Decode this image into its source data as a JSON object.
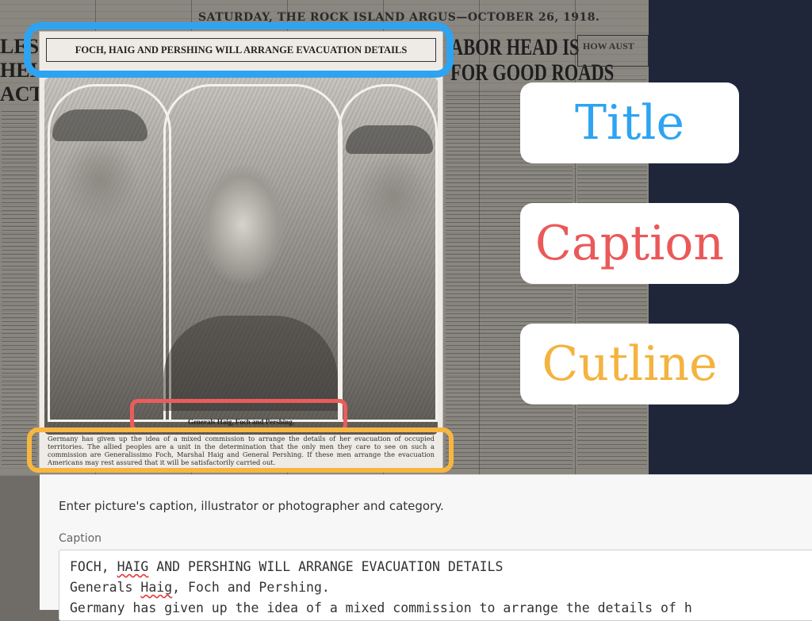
{
  "newspaper": {
    "masthead": "SATURDAY, THE ROCK ISLAND ARGUS—OCTOBER 26, 1918.",
    "left_head": "LES HEL ACT",
    "right_head_1": "ABOR HEAD IS",
    "right_head_2": "FOR GOOD ROADS",
    "right_box": "HOW AUST"
  },
  "article": {
    "headline": "FOCH, HAIG AND PERSHING WILL ARRANGE EVACUATION DETAILS",
    "caption": "Generals Haig, Foch and Pershing.",
    "cutline": "Germany has given up the idea of a mixed commission to arrange the details of her evacuation of occupied territories. The allied peoples are a unit in the determination that the only men they care to see on such a commission are Generalissimo Foch, Marshal Haig and General Pershing. If these men arrange the evacuation Americans may rest assured that it will be satisfactorily carried out."
  },
  "labels": {
    "title": "Title",
    "caption": "Caption",
    "cutline": "Cutline"
  },
  "colors": {
    "title": "#2da4f2",
    "caption": "#ea5959",
    "cutline": "#f4b33e",
    "panel": "#1f263a"
  },
  "form": {
    "description": "Enter picture's caption, illustrator or photographer and category.",
    "caption_label": "Caption",
    "caption_line_1_a": "FOCH, ",
    "caption_line_1_b": "HAIG",
    "caption_line_1_c": " AND PERSHING WILL ARRANGE EVACUATION DETAILS",
    "caption_line_2_a": "Generals ",
    "caption_line_2_b": "Haig",
    "caption_line_2_c": ", Foch and Pershing.",
    "caption_line_3": "Germany has given up the idea of a mixed commission to arrange the details of h"
  }
}
